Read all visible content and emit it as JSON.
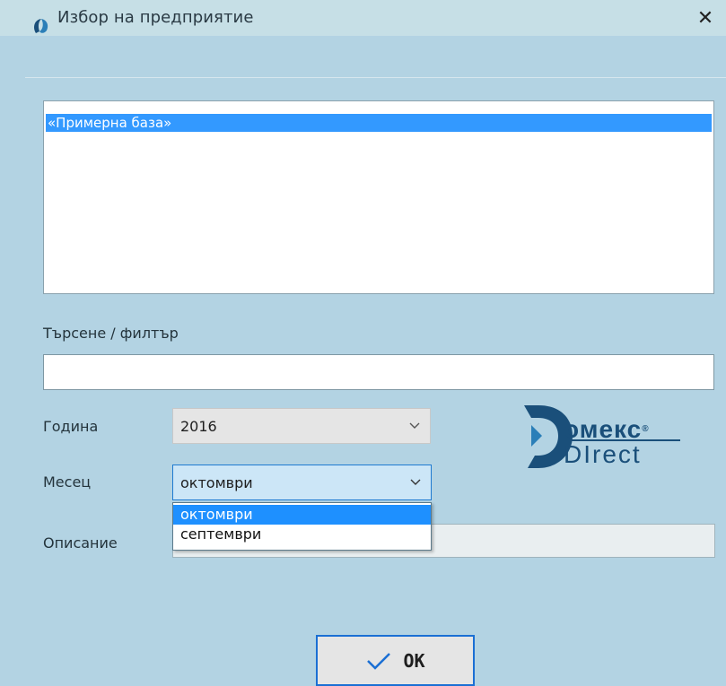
{
  "window": {
    "title": "Избор на предприятие",
    "close_symbol": "✕"
  },
  "companies": {
    "items": [
      "«Примерна база»"
    ],
    "selected_index": 0
  },
  "search": {
    "label": "Търсене / филтър",
    "value": ""
  },
  "year": {
    "label": "Година",
    "value": "2016"
  },
  "month": {
    "label": "Месец",
    "value": "октомври",
    "options": [
      "октомври",
      "септември"
    ],
    "highlighted_option": "октомври"
  },
  "description": {
    "label": "Описание",
    "value": ""
  },
  "logo": {
    "line1": "омекс",
    "line2": "DIrect",
    "reg_mark": "®"
  },
  "ok_button": {
    "label": "OK"
  },
  "icons": {
    "app": "app-logo-icon",
    "close": "close-icon",
    "chevron": "chevron-down-icon",
    "ok": "checkmark-icon"
  },
  "colors": {
    "accent": "#1e90ff",
    "selection": "#3399ff",
    "background": "#b3d3e3",
    "titlebar": "#c6dfe6",
    "logo": "#1a4f7a"
  }
}
